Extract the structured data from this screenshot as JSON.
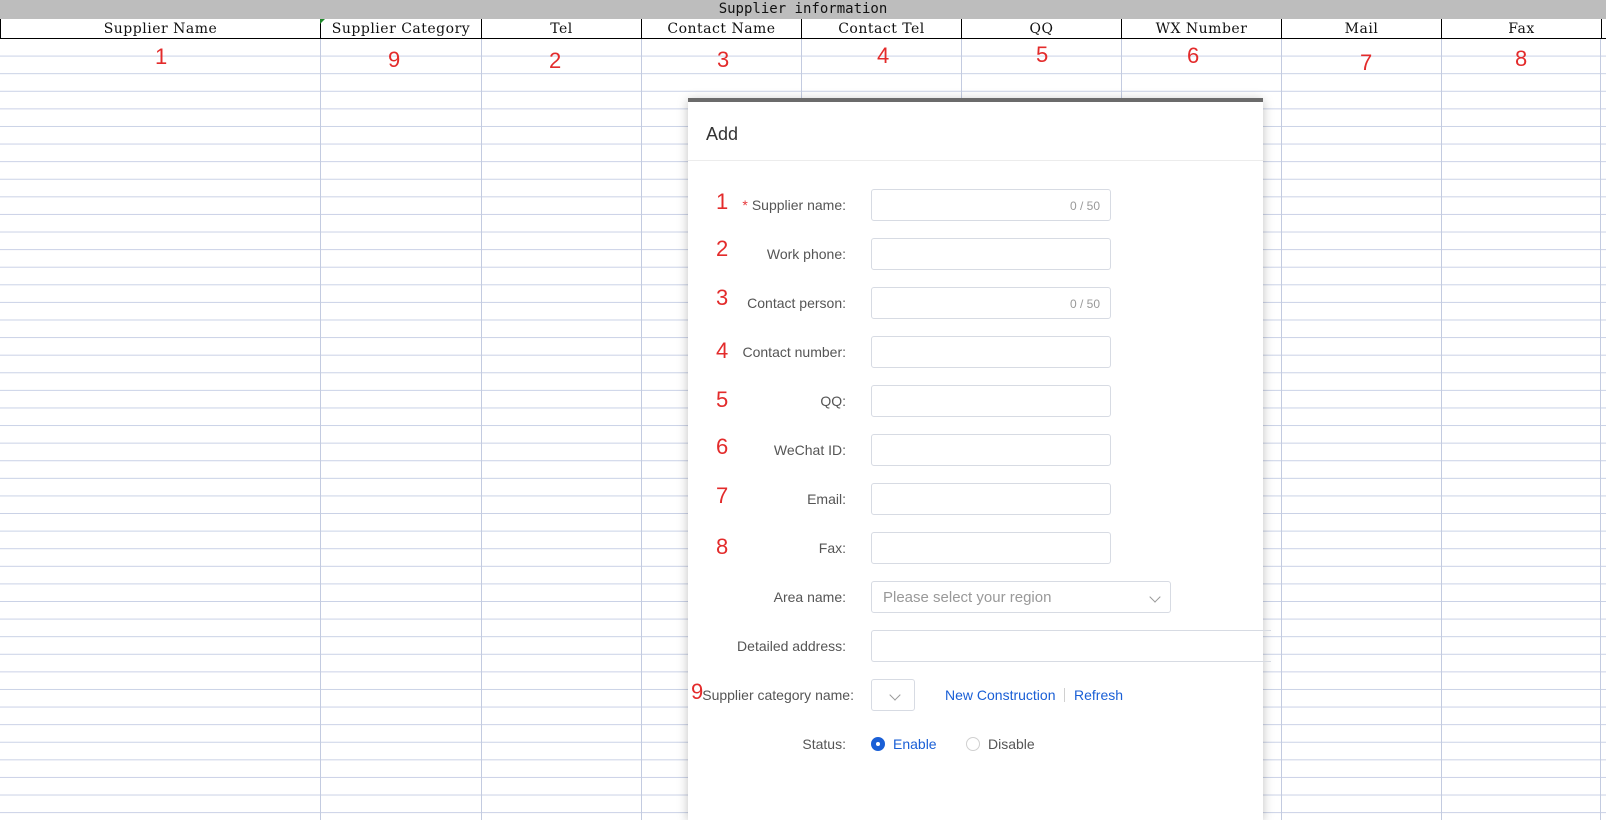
{
  "sheet": {
    "title": "Supplier information",
    "headers": [
      "Supplier Name",
      "Supplier Category",
      "Tel",
      "Contact Name",
      "Contact Tel",
      "QQ",
      "WX Number",
      "Mail",
      "Fax"
    ],
    "marks": [
      "1",
      "9",
      "2",
      "3",
      "4",
      "5",
      "6",
      "7",
      "8"
    ]
  },
  "dialog": {
    "title": "Add",
    "required_mark": "*",
    "rows": [
      {
        "mark": "1",
        "label": "Supplier name:",
        "counter": "0 / 50"
      },
      {
        "mark": "2",
        "label": "Work phone:"
      },
      {
        "mark": "3",
        "label": "Contact person:",
        "counter": "0 / 50"
      },
      {
        "mark": "4",
        "label": "Contact number:"
      },
      {
        "mark": "5",
        "label": "QQ:"
      },
      {
        "mark": "6",
        "label": "WeChat ID:"
      },
      {
        "mark": "7",
        "label": "Email:"
      },
      {
        "mark": "8",
        "label": "Fax:"
      }
    ],
    "area": {
      "label": "Area name:",
      "placeholder": "Please select your region"
    },
    "address": {
      "label": "Detailed address:"
    },
    "category": {
      "mark": "9",
      "label": "Supplier category name:",
      "new_label": "New Construction",
      "refresh_label": "Refresh"
    },
    "status": {
      "label": "Status:",
      "enable": "Enable",
      "disable": "Disable",
      "selected": "Enable"
    }
  },
  "colors": {
    "accent": "#1a5fd6",
    "mark": "#e32b2b",
    "required": "#e6383b"
  }
}
